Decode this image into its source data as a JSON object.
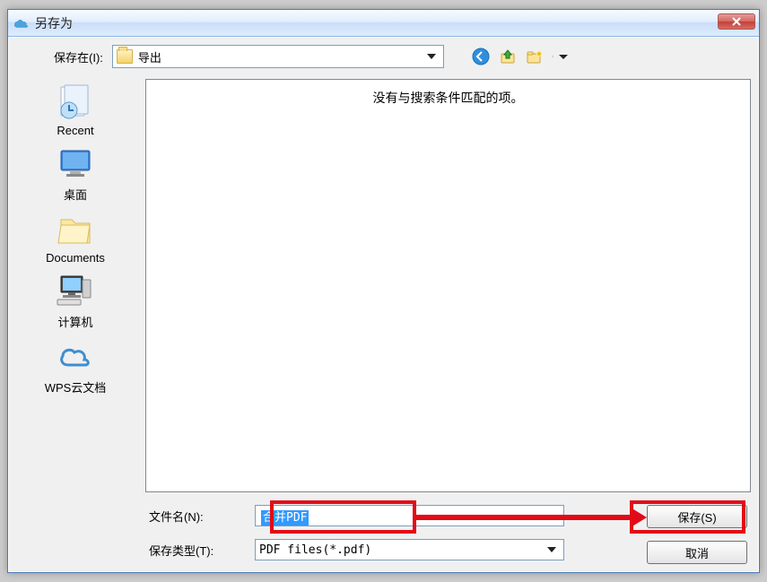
{
  "window": {
    "title": "另存为"
  },
  "topbar": {
    "save_in_label": "保存在(I):",
    "folder_name": "导出"
  },
  "nav_icons": {
    "back": "back-icon",
    "up": "up-icon",
    "newfolder": "new-folder-icon",
    "viewmenu": "view-menu-icon"
  },
  "places": [
    {
      "id": "recent",
      "label": "Recent"
    },
    {
      "id": "desktop",
      "label": "桌面"
    },
    {
      "id": "documents",
      "label": "Documents"
    },
    {
      "id": "computer",
      "label": "计算机"
    },
    {
      "id": "wpscloud",
      "label": "WPS云文档"
    }
  ],
  "filepane": {
    "empty_text": "没有与搜索条件匹配的项。"
  },
  "bottom": {
    "filename_label": "文件名(N):",
    "filename_value": "合并PDF",
    "filetype_label": "保存类型(T):",
    "filetype_value": "PDF files(*.pdf)",
    "save_label": "保存(S)",
    "cancel_label": "取消"
  }
}
